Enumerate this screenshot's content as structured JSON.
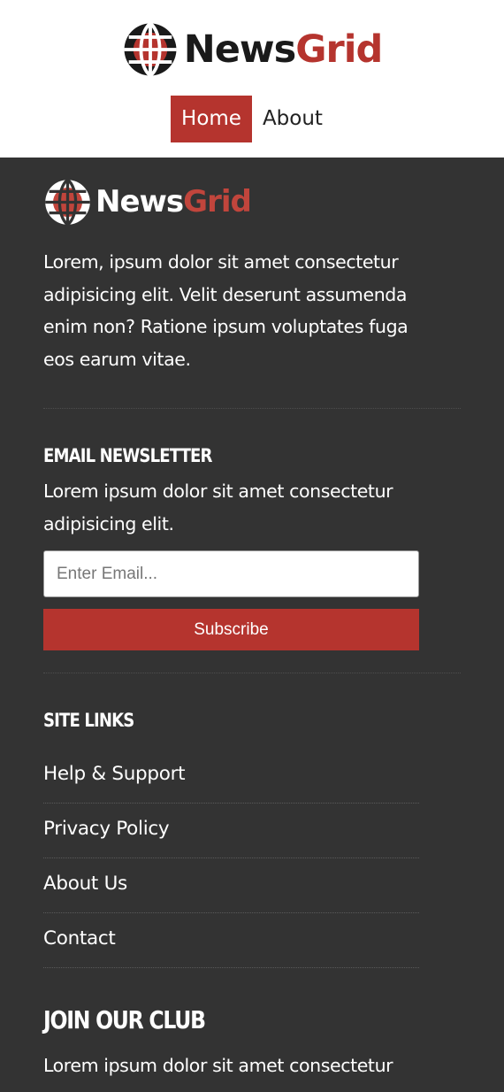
{
  "brand": {
    "name_part1": "News",
    "name_part2": "Grid",
    "accent_color": "#b5342e",
    "icon": "globe-icon"
  },
  "nav": {
    "items": [
      {
        "label": "Home",
        "active": true
      },
      {
        "label": "About",
        "active": false
      }
    ]
  },
  "footer": {
    "about_text": "Lorem, ipsum dolor sit amet consectetur adipisicing elit. Velit deserunt assumenda enim non? Ratione ipsum voluptates fuga eos earum vitae.",
    "newsletter": {
      "title": "Email Newsletter",
      "text": "Lorem ipsum dolor sit amet consectetur adipisicing elit.",
      "input_placeholder": "Enter Email...",
      "input_value": "",
      "button_label": "Subscribe"
    },
    "site_links": {
      "title": "Site Links",
      "items": [
        "Help & Support",
        "Privacy Policy",
        "About Us",
        "Contact"
      ]
    },
    "club": {
      "title": "Join Our Club",
      "text": "Lorem ipsum dolor sit amet consectetur"
    }
  }
}
